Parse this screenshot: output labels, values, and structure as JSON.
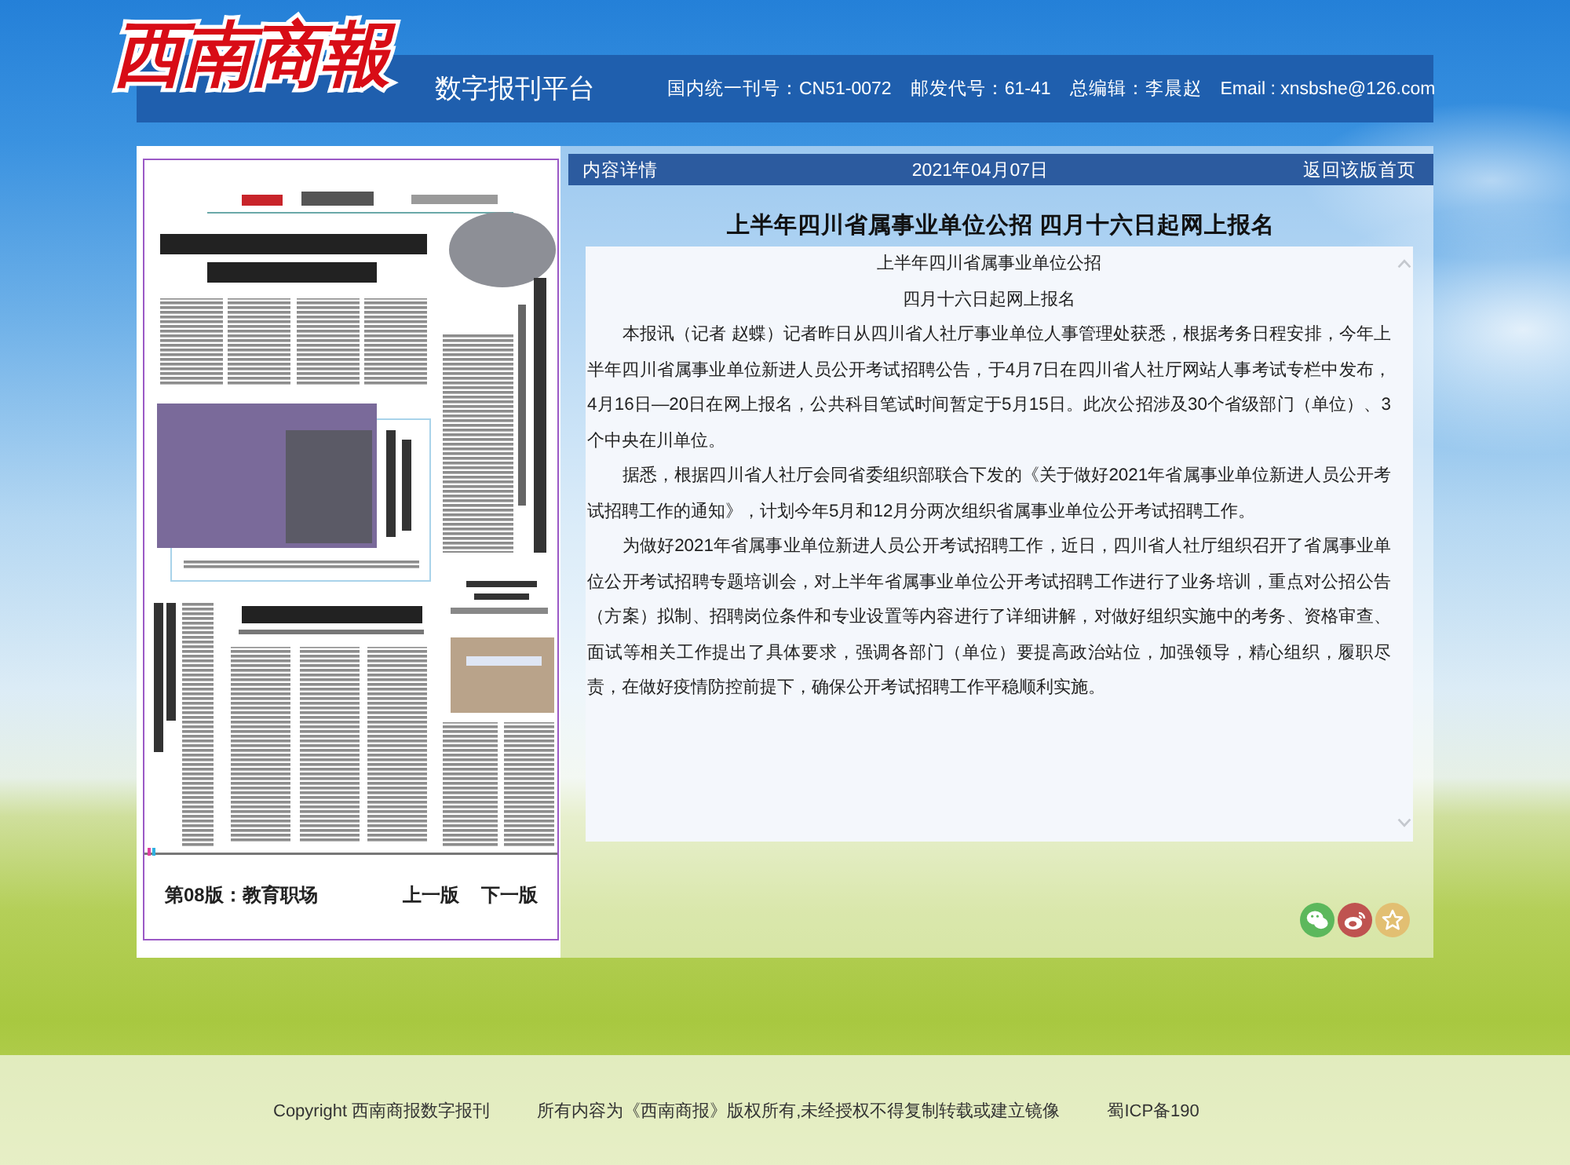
{
  "header": {
    "logo": "西南商報",
    "platform": "数字报刊平台",
    "info": [
      "国内统一刊号：CN51-0072",
      "邮发代号：61-41",
      "总编辑：李晨赵",
      "Email : xnsbshe@126.com"
    ]
  },
  "page_viewer": {
    "edition": "第08版：教育职场",
    "nav_links": [
      "上一版",
      "下一版"
    ]
  },
  "article": {
    "toolbar": {
      "label": "内容详情",
      "date": "2021年04月07日",
      "back_link": "返回该版首页"
    },
    "title": "上半年四川省属事业单位公招 四月十六日起网上报名",
    "subtitles": [
      "上半年四川省属事业单位公招",
      "四月十六日起网上报名"
    ],
    "paragraphs": [
      "本报讯（记者 赵蝶）记者昨日从四川省人社厅事业单位人事管理处获悉，根据考务日程安排，今年上半年四川省属事业单位新进人员公开考试招聘公告，于4月7日在四川省人社厅网站人事考试专栏中发布，4月16日—20日在网上报名，公共科目笔试时间暂定于5月15日。此次公招涉及30个省级部门（单位）、3个中央在川单位。",
      "据悉，根据四川省人社厅会同省委组织部联合下发的《关于做好2021年省属事业单位新进人员公开考试招聘工作的通知》，计划今年5月和12月分两次组织省属事业单位公开考试招聘工作。",
      "为做好2021年省属事业单位新进人员公开考试招聘工作，近日，四川省人社厅组织召开了省属事业单位公开考试招聘专题培训会，对上半年省属事业单位公开考试招聘工作进行了业务培训，重点对公招公告（方案）拟制、招聘岗位条件和专业设置等内容进行了详细讲解，对做好组织实施中的考务、资格审查、面试等相关工作提出了具体要求，强调各部门（单位）要提高政治站位，加强领导，精心组织，履职尽责，在做好疫情防控前提下，确保公开考试招聘工作平稳顺利实施。"
    ]
  },
  "share_buttons": [
    {
      "kind": "wechat"
    },
    {
      "kind": "weibo"
    },
    {
      "kind": "favorite"
    }
  ],
  "footer": {
    "items": [
      "Copyright 西南商报数字报刊",
      "所有内容为《西南商报》版权所有,未经授权不得复制转载或建立镜像",
      "蜀ICP备190"
    ]
  }
}
